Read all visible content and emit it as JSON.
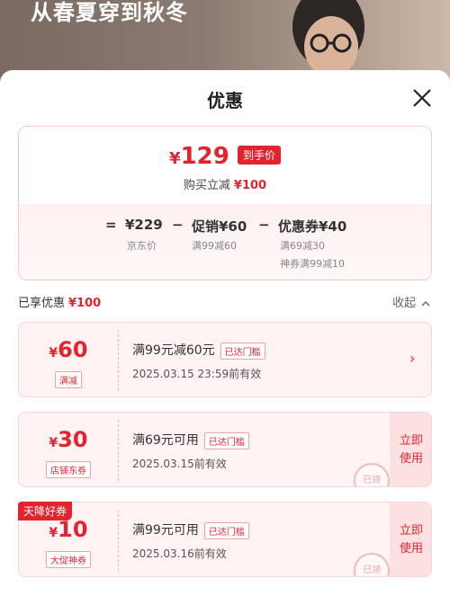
{
  "background": {
    "headline": "从春夏穿到秋冬"
  },
  "sheet": {
    "title": "优惠"
  },
  "summary": {
    "currency": "¥",
    "final_price": "129",
    "price_tag": "到手价",
    "buy_reduce_label": "购买立减",
    "buy_reduce_amount": "¥100",
    "equals": "=",
    "minus": "−",
    "jd_price": "¥229",
    "jd_price_label": "京东价",
    "promo_price": "促销¥60",
    "promo_rule": "满99减60",
    "coupon_price": "优惠券¥40",
    "coupon_rule_1": "满69减30",
    "coupon_rule_2": "神券满99减10"
  },
  "section": {
    "enjoyed_label": "已享优惠",
    "enjoyed_amount": "¥100",
    "collapse_label": "收起"
  },
  "coupons": [
    {
      "currency": "¥",
      "amount": "60",
      "type": "满减",
      "condition": "满99元减60元",
      "badge": "已达门槛",
      "valid": "2025.03.15 23:59前有效"
    },
    {
      "currency": "¥",
      "amount": "30",
      "type": "店铺东券",
      "condition": "满69元可用",
      "badge": "已达门槛",
      "valid": "2025.03.15前有效",
      "action": "立即使用",
      "stamp": "已领"
    },
    {
      "currency": "¥",
      "amount": "10",
      "type": "大促神券",
      "condition": "满99元可用",
      "badge": "已达门槛",
      "valid": "2025.03.16前有效",
      "action": "立即使用",
      "stamp": "已领",
      "ribbon": "天降好券"
    }
  ],
  "colors": {
    "accent": "#e4232f",
    "card_bg": "#fff3f4"
  }
}
